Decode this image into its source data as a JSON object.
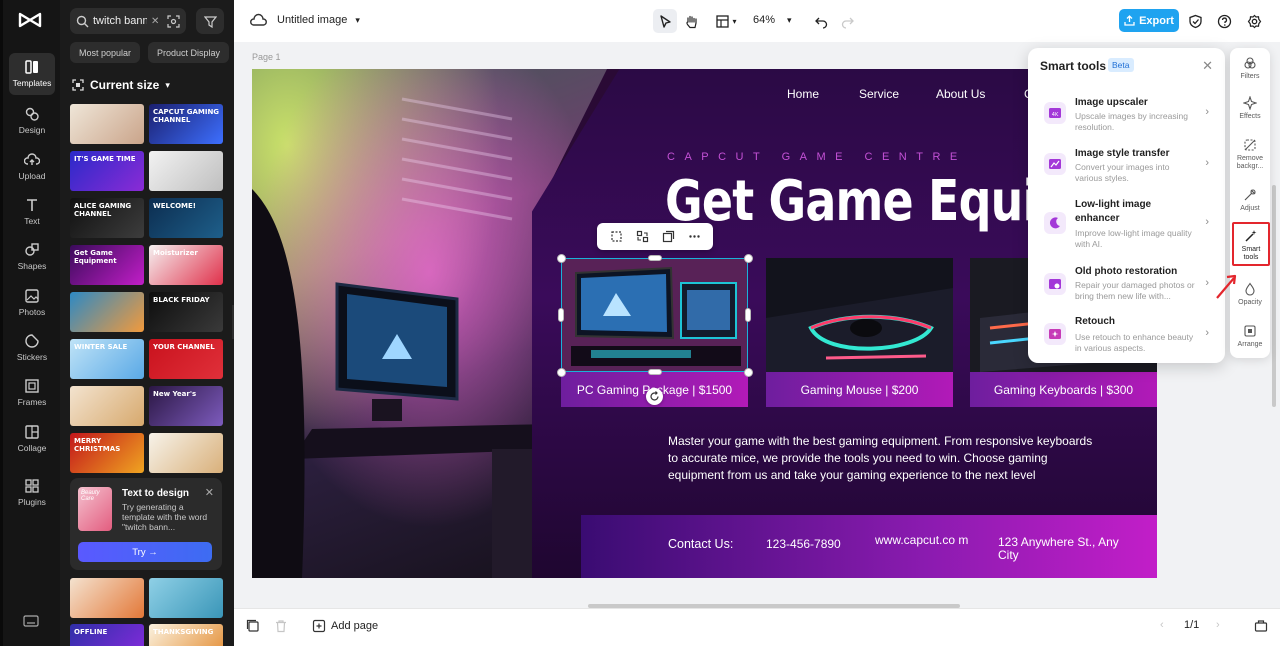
{
  "rail": {
    "items": [
      {
        "label": "Templates"
      },
      {
        "label": "Design"
      },
      {
        "label": "Upload"
      },
      {
        "label": "Text"
      },
      {
        "label": "Shapes"
      },
      {
        "label": "Photos"
      },
      {
        "label": "Stickers"
      },
      {
        "label": "Frames"
      },
      {
        "label": "Collage"
      },
      {
        "label": "Plugins"
      }
    ]
  },
  "panel": {
    "search_value": "twitch bann",
    "chips": [
      "Most popular",
      "Product Display"
    ],
    "size_label": "Current size",
    "thumbs": [
      {
        "text": "",
        "c1": "#efe6d8",
        "c2": "#caa48a"
      },
      {
        "text": "CAPCUT GAMING CHANNEL",
        "c1": "#1b1f6e",
        "c2": "#3d6fff"
      },
      {
        "text": "IT'S GAME TIME",
        "c1": "#2a2ac9",
        "c2": "#8b2bd6"
      },
      {
        "text": "",
        "c1": "#f2f2f2",
        "c2": "#bfbfbf"
      },
      {
        "text": "ALICE GAMING CHANNEL",
        "c1": "#101010",
        "c2": "#3d3d3d"
      },
      {
        "text": "WELCOME!",
        "c1": "#0c2d50",
        "c2": "#1e5f8a"
      },
      {
        "text": "Get Game Equipment",
        "c1": "#3a0b5a",
        "c2": "#c21ec8"
      },
      {
        "text": "Moisturizer",
        "c1": "#f5f0f0",
        "c2": "#e0304a"
      },
      {
        "text": "",
        "c1": "#2d89c4",
        "c2": "#f29a3c"
      },
      {
        "text": "BLACK FRIDAY",
        "c1": "#0d0d0d",
        "c2": "#3a3a3a"
      },
      {
        "text": "WINTER SALE",
        "c1": "#bfe3f7",
        "c2": "#5aa9e6"
      },
      {
        "text": "YOUR CHANNEL",
        "c1": "#c9121d",
        "c2": "#e0303a"
      },
      {
        "text": "",
        "c1": "#f3e3cf",
        "c2": "#d7a96d"
      },
      {
        "text": "New Year's",
        "c1": "#2b1744",
        "c2": "#7d5bbd"
      },
      {
        "text": "MERRY CHRISTMAS",
        "c1": "#c2161b",
        "c2": "#f0a521"
      },
      {
        "text": "",
        "c1": "#f7f3ea",
        "c2": "#d9b07a"
      },
      {
        "text": "",
        "c1": "#f4e2cf",
        "c2": "#e37838"
      },
      {
        "text": "",
        "c1": "#8fd0e6",
        "c2": "#3a96b8"
      },
      {
        "text": "OFFLINE",
        "c1": "#2f2fa8",
        "c2": "#8a2be0"
      },
      {
        "text": "THANKSGIVING",
        "c1": "#fbf2df",
        "c2": "#e2882c"
      }
    ],
    "promo": {
      "badge": "Beauty Care",
      "title": "Text to design",
      "desc": "Try generating a template with the word \"twitch bann...",
      "button": "Try →"
    }
  },
  "topbar": {
    "doc_title": "Untitled image",
    "zoom": "64%",
    "export": "Export"
  },
  "canvas": {
    "page_label": "Page 1",
    "nav": [
      "Home",
      "Service",
      "About Us",
      "C"
    ],
    "subhead": "CAPCUT GAME CENTRE",
    "headline": "Get Game Equipme",
    "products": [
      "PC Gaming Package | $1500",
      "Gaming Mouse | $200",
      "Gaming Keyboards | $300"
    ],
    "body": "Master your game with the best gaming equipment. From responsive keyboards to accurate mice, we provide the tools you need to win. Choose gaming equipment from us and take your gaming experience to the next level",
    "contact_label": "Contact Us:",
    "phone": "123-456-7890",
    "website": "www.capcut.co m",
    "address": "123 Anywhere St., Any City"
  },
  "smart_tools": {
    "title": "Smart tools",
    "beta": "Beta",
    "items": [
      {
        "name": "Image upscaler",
        "desc": "Upscale images by increasing resolution."
      },
      {
        "name": "Image style transfer",
        "desc": "Convert your images into various styles."
      },
      {
        "name": "Low-light image enhancer",
        "desc": "Improve low-light image quality with AI."
      },
      {
        "name": "Old photo restoration",
        "desc": "Repair your damaged photos or bring them new life with..."
      },
      {
        "name": "Retouch",
        "desc": "Use retouch to enhance beauty in various aspects."
      }
    ]
  },
  "right_rail": {
    "items": [
      {
        "label": "Filters"
      },
      {
        "label": "Effects"
      },
      {
        "label": "Remove backgr..."
      },
      {
        "label": "Adjust"
      },
      {
        "label": "Smart tools"
      },
      {
        "label": "Opacity"
      },
      {
        "label": "Arrange"
      }
    ]
  },
  "bottombar": {
    "add_page": "Add page",
    "page_count": "1/1"
  },
  "colors": {
    "accent": "#1fa3f0",
    "highlight_red": "#e3262d",
    "selection": "#1ab2d8"
  }
}
